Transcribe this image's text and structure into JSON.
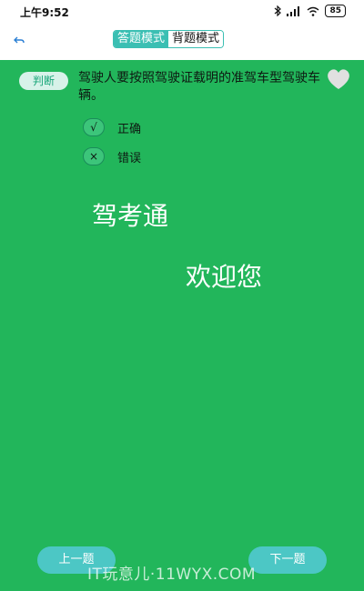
{
  "status_bar": {
    "time": "上午9:52",
    "battery": "85",
    "icons": [
      "bluetooth-icon",
      "signal-icon",
      "wifi-icon",
      "battery-icon"
    ]
  },
  "header": {
    "back_icon": "back-arrow-icon",
    "tabs": [
      {
        "label": "答题模式",
        "active": true
      },
      {
        "label": "背题模式",
        "active": false
      }
    ]
  },
  "question": {
    "type_badge": "判断",
    "text": "驾驶人要按照驾驶证载明的准驾车型驾驶车辆。",
    "favorite_icon": "heart-icon",
    "options": [
      {
        "symbol": "√",
        "label": "正确"
      },
      {
        "symbol": "×",
        "label": "错误"
      }
    ]
  },
  "overlay_text": {
    "line1": "驾考通",
    "line2": "欢迎您"
  },
  "nav": {
    "prev_label": "上一题",
    "next_label": "下一题"
  },
  "watermark": "IT玩意儿·11WYX.COM",
  "colors": {
    "background": "#22b65b",
    "accent": "#3bbfb3",
    "nav_button": "#4cc7c5"
  }
}
